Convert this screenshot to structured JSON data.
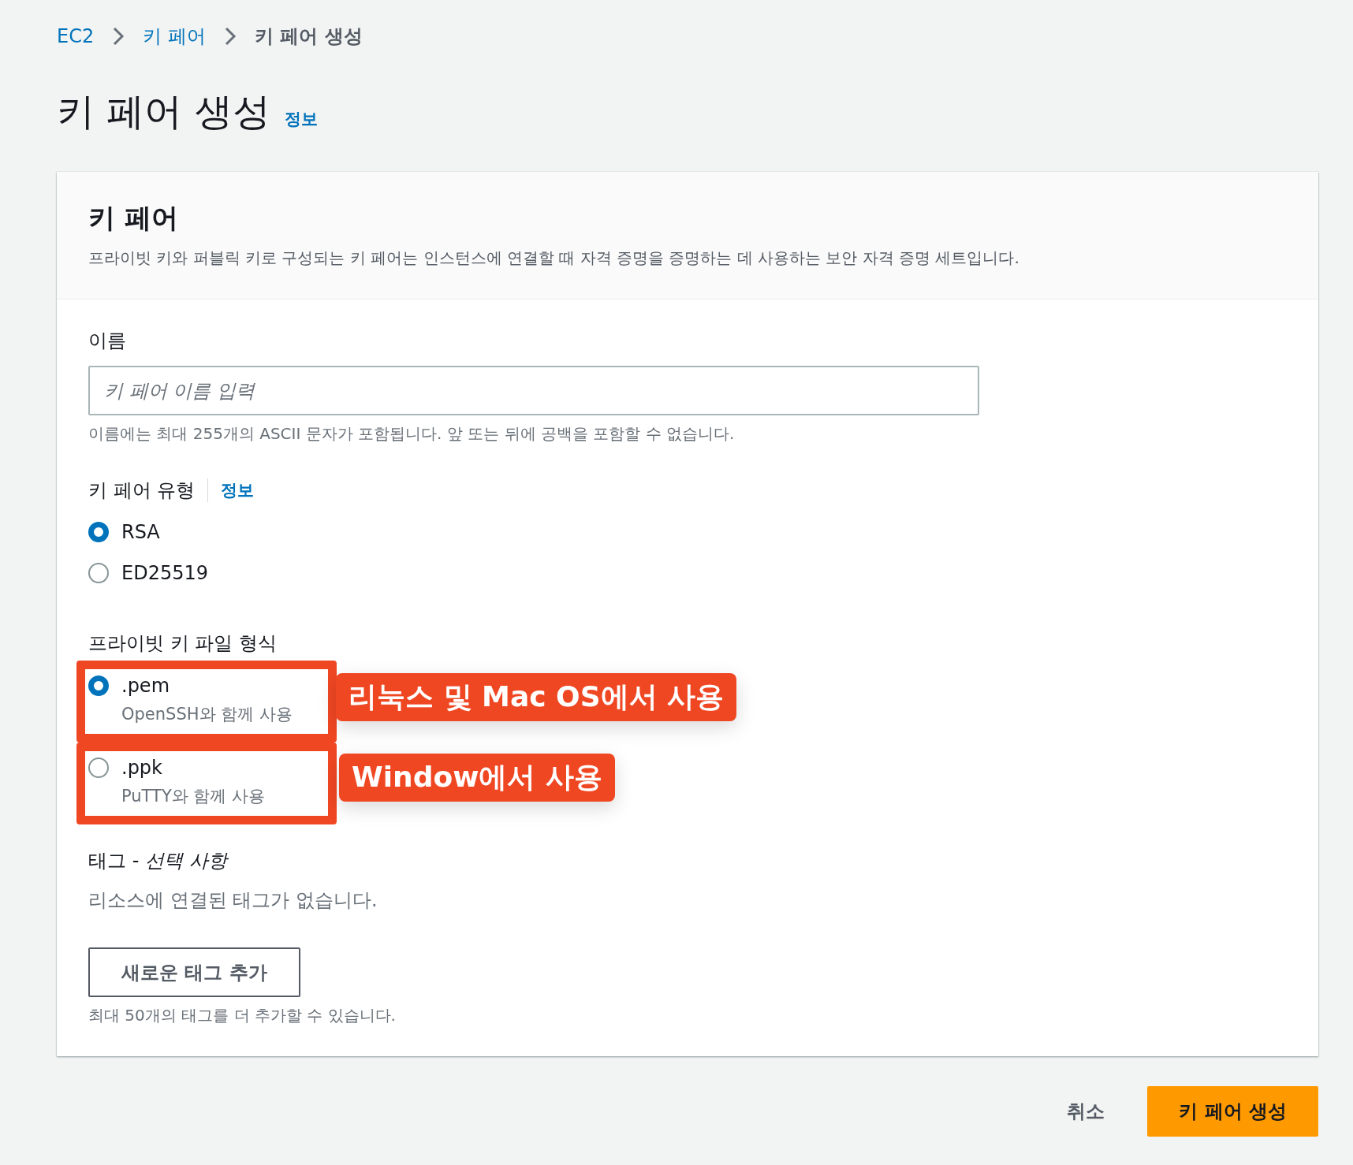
{
  "breadcrumb": [
    {
      "label": "EC2",
      "link": true
    },
    {
      "label": "키 페어",
      "link": true
    },
    {
      "label": "키 페어 생성",
      "link": false
    }
  ],
  "page_title": "키 페어 생성",
  "page_info_link": "정보",
  "card": {
    "title": "키 페어",
    "description": "프라이빗 키와 퍼블릭 키로 구성되는 키 페어는 인스턴스에 연결할 때 자격 증명을 증명하는 데 사용하는 보안 자격 증명 세트입니다."
  },
  "name_field": {
    "label": "이름",
    "placeholder": "키 페어 이름 입력",
    "hint": "이름에는 최대 255개의 ASCII 문자가 포함됩니다. 앞 또는 뒤에 공백을 포함할 수 없습니다."
  },
  "key_type": {
    "label": "키 페어 유형",
    "info_link": "정보",
    "options": [
      {
        "label": "RSA",
        "selected": true
      },
      {
        "label": "ED25519",
        "selected": false
      }
    ]
  },
  "file_format": {
    "label": "프라이빗 키 파일 형식",
    "options": [
      {
        "label": ".pem",
        "description": "OpenSSH와 함께 사용",
        "selected": true,
        "annotation": "리눅스 및 Mac OS에서 사용"
      },
      {
        "label": ".ppk",
        "description": "PuTTY와 함께 사용",
        "selected": false,
        "annotation": "Window에서 사용"
      }
    ]
  },
  "tags": {
    "label": "태그 - *선택 사항*",
    "empty_text": "리소스에 연결된 태그가 없습니다.",
    "add_button": "새로운 태그 추가",
    "hint": "최대 50개의 태그를 더 추가할 수 있습니다."
  },
  "footer": {
    "cancel": "취소",
    "submit": "키 페어 생성"
  }
}
